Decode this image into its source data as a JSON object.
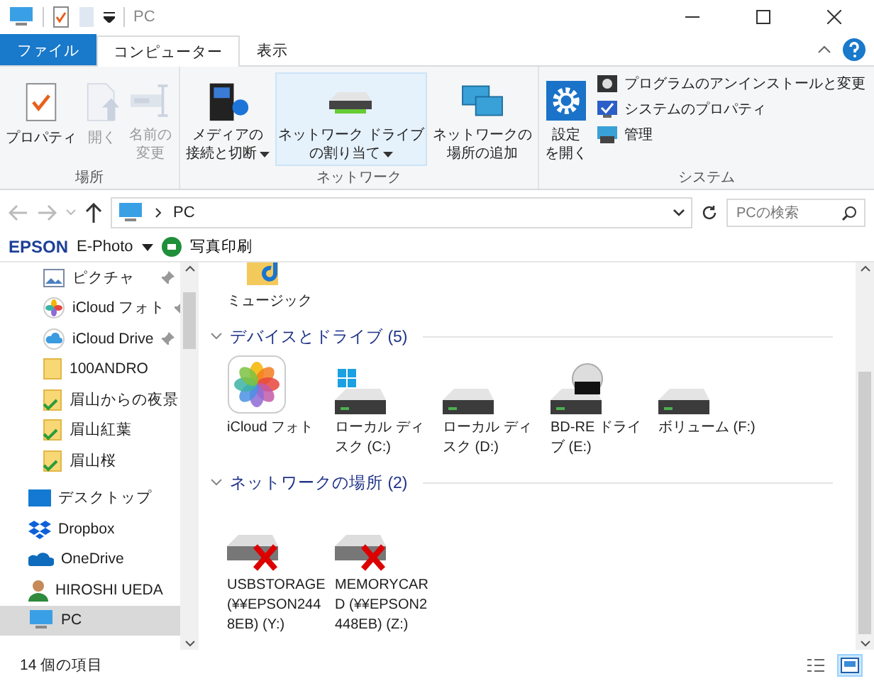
{
  "window": {
    "title": "PC"
  },
  "ribbon_tabs": [
    {
      "label": "ファイル",
      "kind": "file",
      "selected": false
    },
    {
      "label": "コンピューター",
      "kind": "tab",
      "selected": true
    },
    {
      "label": "表示",
      "kind": "tab",
      "selected": false
    }
  ],
  "ribbon_groups": [
    {
      "label": "場所",
      "items": [
        {
          "lines": [
            "プロパティ"
          ],
          "kind": "properties",
          "disabled": false,
          "dropdown": false,
          "highlighted": false
        },
        {
          "lines": [
            "開く"
          ],
          "kind": "open",
          "disabled": true,
          "dropdown": false,
          "highlighted": false
        },
        {
          "lines": [
            "名前の",
            "変更"
          ],
          "kind": "rename",
          "disabled": true,
          "dropdown": false,
          "highlighted": false
        }
      ]
    },
    {
      "label": "ネットワーク",
      "items": [
        {
          "lines": [
            "メディアの",
            "接続と切断"
          ],
          "kind": "media",
          "disabled": false,
          "dropdown": true,
          "highlighted": false
        },
        {
          "lines": [
            "ネットワーク ドライブ",
            "の割り当て"
          ],
          "kind": "netdrive",
          "disabled": false,
          "dropdown": true,
          "highlighted": true
        },
        {
          "lines": [
            "ネットワークの",
            "場所の追加"
          ],
          "kind": "netplace",
          "disabled": false,
          "dropdown": false,
          "highlighted": false
        }
      ]
    },
    {
      "label": "システム",
      "items": [
        {
          "lines": [
            "設定",
            "を開く"
          ],
          "kind": "settings",
          "disabled": false,
          "dropdown": false,
          "highlighted": false
        }
      ],
      "small_items": [
        {
          "label": "プログラムのアンインストールと変更",
          "kind": "uninstall"
        },
        {
          "label": "システムのプロパティ",
          "kind": "sysprops"
        },
        {
          "label": "管理",
          "kind": "manage"
        }
      ]
    }
  ],
  "address": {
    "path": "PC",
    "search_placeholder": "PCの検索"
  },
  "epson_bar": {
    "brand": "EPSON",
    "product": "E-Photo",
    "action": "写真印刷"
  },
  "sidebar": {
    "items": [
      {
        "label": "ピクチャ",
        "kind": "pictures",
        "pinned": true,
        "selected": false
      },
      {
        "label": "iCloud フォト",
        "kind": "icloud-photos",
        "pinned": true,
        "selected": false
      },
      {
        "label": "iCloud Drive",
        "kind": "icloud-drive",
        "pinned": true,
        "selected": false
      },
      {
        "label": "100ANDRO",
        "kind": "folder",
        "pinned": false,
        "selected": false
      },
      {
        "label": "眉山からの夜景",
        "kind": "synced-folder",
        "pinned": false,
        "selected": false
      },
      {
        "label": "眉山紅葉",
        "kind": "synced-folder",
        "pinned": false,
        "selected": false
      },
      {
        "label": "眉山桜",
        "kind": "synced-folder",
        "pinned": false,
        "selected": false
      },
      {
        "label": "デスクトップ",
        "kind": "desktop",
        "pinned": false,
        "selected": false
      },
      {
        "label": "Dropbox",
        "kind": "dropbox",
        "pinned": false,
        "selected": false
      },
      {
        "label": "OneDrive",
        "kind": "onedrive",
        "pinned": false,
        "selected": false
      },
      {
        "label": "HIROSHI UEDA",
        "kind": "user",
        "pinned": false,
        "selected": false
      },
      {
        "label": "PC",
        "kind": "pc",
        "pinned": false,
        "selected": true
      }
    ]
  },
  "content": {
    "partial_item": {
      "label": "ミュージック"
    },
    "groups": [
      {
        "title": "デバイスとドライブ",
        "count": "(5)",
        "expanded": true,
        "items": [
          {
            "label": "iCloud フォト",
            "kind": "photos"
          },
          {
            "label": "ローカル ディスク (C:)",
            "kind": "system-drive"
          },
          {
            "label": "ローカル ディスク (D:)",
            "kind": "drive"
          },
          {
            "label": "BD-RE ドライブ (E:)",
            "kind": "bd-drive"
          },
          {
            "label": "ボリューム (F:)",
            "kind": "drive"
          }
        ]
      },
      {
        "title": "ネットワークの場所",
        "count": "(2)",
        "expanded": true,
        "items": [
          {
            "label": "USBSTORAGE (¥¥EPSON2448EB) (Y:)",
            "kind": "network-disconnected"
          },
          {
            "label": "MEMORYCARD (¥¥EPSON2448EB) (Z:)",
            "kind": "network-disconnected"
          }
        ]
      }
    ]
  },
  "status_bar": {
    "item_count": "14 個の項目",
    "view_buttons": [
      {
        "kind": "details",
        "selected": false
      },
      {
        "kind": "large-icons",
        "selected": true
      }
    ]
  }
}
